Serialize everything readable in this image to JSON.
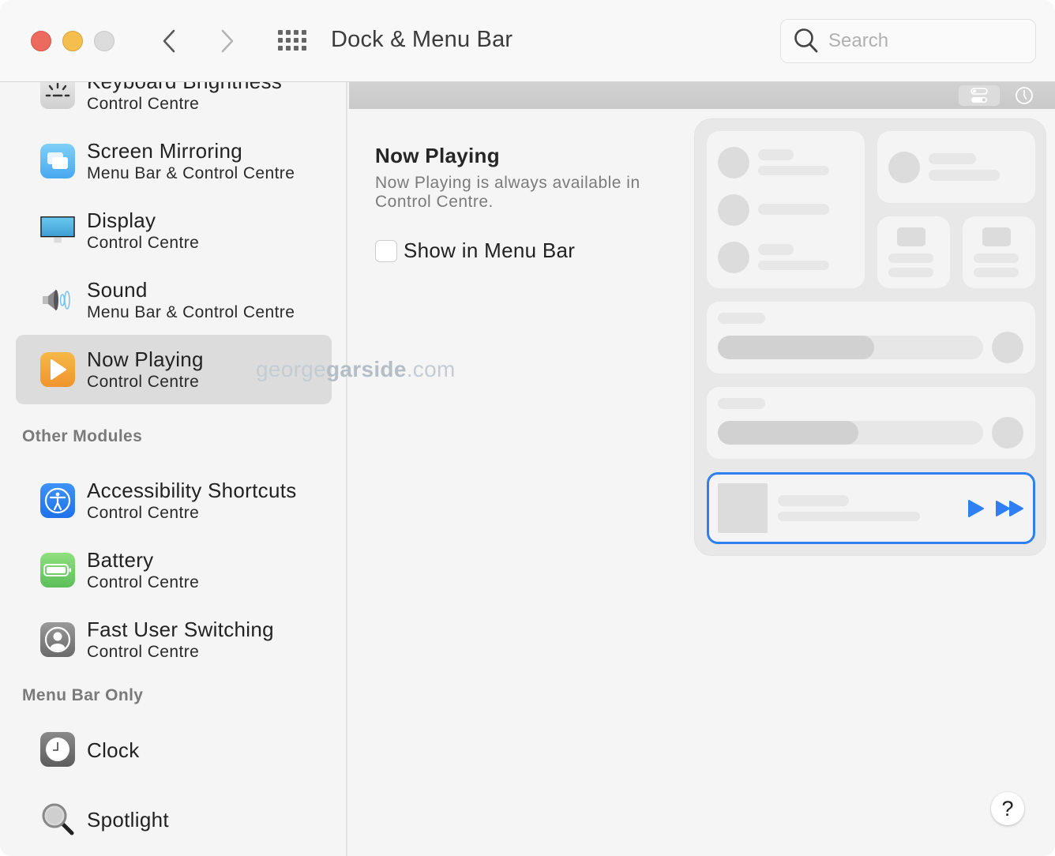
{
  "window": {
    "title": "Dock & Menu Bar",
    "search_placeholder": "Search",
    "search_value": ""
  },
  "sidebar": {
    "items": [
      {
        "id": "keyboard-brightness",
        "title": "Keyboard Brightness",
        "subtitle": "Control Centre",
        "icon": "keyboard-brightness-icon"
      },
      {
        "id": "screen-mirroring",
        "title": "Screen Mirroring",
        "subtitle": "Menu Bar & Control Centre",
        "icon": "screen-mirroring-icon"
      },
      {
        "id": "display",
        "title": "Display",
        "subtitle": "Control Centre",
        "icon": "display-icon"
      },
      {
        "id": "sound",
        "title": "Sound",
        "subtitle": "Menu Bar & Control Centre",
        "icon": "speaker-icon"
      },
      {
        "id": "now-playing",
        "title": "Now Playing",
        "subtitle": "Control Centre",
        "icon": "play-icon",
        "selected": true
      }
    ],
    "sections": {
      "other_modules": "Other Modules",
      "menu_bar_only": "Menu Bar Only"
    },
    "other_modules": [
      {
        "id": "accessibility-shortcuts",
        "title": "Accessibility Shortcuts",
        "subtitle": "Control Centre",
        "icon": "accessibility-icon"
      },
      {
        "id": "battery",
        "title": "Battery",
        "subtitle": "Control Centre",
        "icon": "battery-icon"
      },
      {
        "id": "fast-user-switching",
        "title": "Fast User Switching",
        "subtitle": "Control Centre",
        "icon": "user-icon"
      }
    ],
    "menu_bar_only": [
      {
        "id": "clock",
        "title": "Clock",
        "icon": "clock-icon"
      },
      {
        "id": "spotlight",
        "title": "Spotlight",
        "icon": "spotlight-icon"
      }
    ]
  },
  "detail": {
    "heading": "Now Playing",
    "description": "Now Playing is always available in Control Centre.",
    "checkbox_label": "Show in Menu Bar",
    "checkbox_checked": false
  },
  "preview": {
    "slider_1_fill": 0.59,
    "slider_2_fill": 0.53,
    "accent_color": "#2f7ff2"
  },
  "watermark": {
    "light": "george",
    "bold": "garside",
    "suffix": ".com"
  },
  "help_label": "?"
}
